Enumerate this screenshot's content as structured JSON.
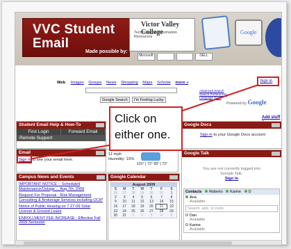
{
  "banner": {
    "title_line1": "VVC Student",
    "title_line2": "Email",
    "made_by": "Made possible by:",
    "college_name": "Victor Valley College",
    "college_sub": "Technology & Information Resources",
    "sponsor_logos": [
      "Microsoft",
      "",
      "",
      "DELL"
    ],
    "google_badge": "Google"
  },
  "top_right": {
    "sign_in": "Sign in",
    "add_stuff": "Add stuff »"
  },
  "search": {
    "nav_bold": "Web",
    "nav_links": [
      "Images",
      "Groups",
      "News",
      "Shopping",
      "Maps",
      "Scholar",
      "more »"
    ],
    "google_search_btn": "Google Search",
    "lucky_btn": "I'm Feeling Lucky",
    "adv_links": [
      "Advanced Search",
      "Search Preferences",
      "Language Tools"
    ],
    "powered_by": "Powered by",
    "powered_brand": "Google"
  },
  "callout": {
    "text": "Click on either one."
  },
  "help": {
    "title": "Student Email Help & How-To",
    "tabs": [
      "First Login",
      "Forward Email"
    ],
    "remote": "Remote Support"
  },
  "email": {
    "title": "Email",
    "sign_in": "Sign in",
    "rest": "to see your email here."
  },
  "weather": {
    "wind": "11 mph",
    "humidity": "Humidity: 15%",
    "temps": "101° | 72°   99° | 72°"
  },
  "news": {
    "title": "Campus News and Events",
    "items": [
      "IMPORTANT NOTICE -- Scheduled Maintenance/Outage ... Aug 7th, 2009",
      "Request For Proposal - Risk Management Consulting & Brokerage Services including OCIP",
      "Notice of Public Hearing on 7-27-09 Solar License & Ground Lease",
      "ENROLLMENT FEE INCREASE - Effective Fall 2009 Semester"
    ]
  },
  "calendar": {
    "title": "Google Calendar",
    "month": "August 2009",
    "dow": [
      "S",
      "M",
      "T",
      "W",
      "T",
      "F",
      "S"
    ],
    "weeks": [
      [
        "26",
        "27",
        "28",
        "29",
        "30",
        "31",
        "1"
      ],
      [
        "2",
        "3",
        "4",
        "5",
        "6",
        "7",
        "8"
      ],
      [
        "9",
        "10",
        "11",
        "12",
        "13",
        "14",
        "15"
      ],
      [
        "16",
        "17",
        "18",
        "19",
        "20",
        "21",
        "22"
      ],
      [
        "23",
        "24",
        "25",
        "26",
        "27",
        "28",
        "29"
      ],
      [
        "30",
        "31",
        "1",
        "2",
        "3",
        "4",
        "5"
      ]
    ]
  },
  "docs": {
    "title": "Google Docs",
    "sign_in": "Sign in",
    "rest": "to your Google Docs account"
  },
  "talk": {
    "title": "Google Talk",
    "line1": "You are not currently logged into",
    "line2": "Google Talk.",
    "sign_in": "Sign In",
    "contacts_label": "Contacts",
    "contacts_names": [
      "Roberto",
      "Karine",
      "D"
    ],
    "search_placeholder": "Search, add, or invite",
    "people": [
      {
        "name": "Ana",
        "status": "Available"
      },
      {
        "name": "Dan",
        "status": "Available"
      },
      {
        "name": "Karine",
        "status": "Available"
      }
    ]
  }
}
